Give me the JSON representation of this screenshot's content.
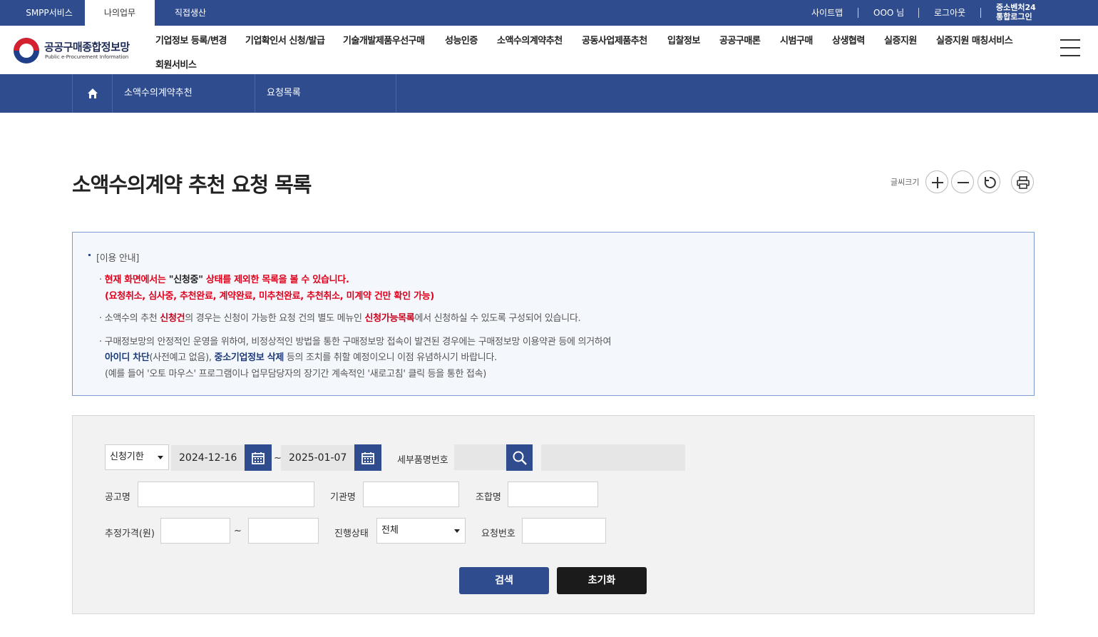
{
  "topbar": {
    "tabs": [
      {
        "label": "SMPP서비스",
        "active": false
      },
      {
        "label": "나의업무",
        "active": true
      },
      {
        "label": "직접생산",
        "active": false
      }
    ],
    "util": {
      "sitemap": "사이트맵",
      "user": "OOO 님",
      "logout": "로그아웃",
      "login24_line1": "중소벤처24",
      "login24_line2": "통합로그인"
    }
  },
  "header": {
    "logo_title": "공공구매종합정보망",
    "logo_sub": "Public e-Procurement Information",
    "gnb": [
      "기업정보 등록/변경",
      "기업확인서 신청/발급",
      "기술개발제품우선구매",
      "성능인증",
      "소액수의계약추천",
      "공동사업제품추천",
      "입찰정보",
      "공공구매론",
      "시범구매",
      "상생협력",
      "실증지원",
      "실증지원 매칭서비스",
      "회원서비스"
    ]
  },
  "location": {
    "crumb1": "소액수의계약추천",
    "crumb2": "요청목록"
  },
  "page": {
    "title": "소액수의계약 추천 요청 목록",
    "font_size_label": "글씨크기"
  },
  "notice": {
    "heading": "[이용 안내]",
    "l1_a": "· ",
    "l1_b": "현재 화면에서는 ",
    "l1_c": "\"신청중\"",
    "l1_d": " 상태를 제외한 목록을 볼 수 있습니다.",
    "l2": "(요청취소, 심사중, 추천완료, 계약완료, 미추천완료, 추천취소, 미계약 건만 확인 가능)",
    "l3_a": "· 소액수의 추천 ",
    "l3_b": "신청건",
    "l3_c": "의 경우는 신청이 가능한 요청 건의 별도 메뉴인 ",
    "l3_d": "신청가능목록",
    "l3_e": "에서 신청하실 수 있도록 구성되어 있습니다.",
    "l4": "· 구매정보망의 안정적인 운영을 위하여, 비정상적인 방법을 통한 구매정보망 접속이 발견된 경우에는 구매정보망 이용약관 등에 의거하여",
    "l5_a": "아이디 차단",
    "l5_b": "(사전예고 없음), ",
    "l5_c": "중소기업정보 삭제",
    "l5_d": " 등의 조치를 취할 예정이오니 이점 유념하시기 바랍니다.",
    "l6": "(예를 들어 '오토 마우스' 프로그램이나 업무담당자의 장기간 계속적인 '새로고침' 클릭 등을 통한 접속)"
  },
  "search": {
    "period_select": "신청기한",
    "date_from": "2024-12-16",
    "date_sep": "~",
    "date_to": "2025-01-07",
    "item_no_label": "세부품명번호",
    "notice_name_label": "공고명",
    "agency_label": "기관명",
    "union_label": "조합명",
    "price_label": "추정가격(원)",
    "price_sep": "~",
    "status_label": "진행상태",
    "status_value": "전체",
    "request_no_label": "요청번호",
    "search_button": "검색",
    "reset_button": "초기화"
  },
  "colors": {
    "primary": "#2f4c8f",
    "notice_border": "#7d9cd0",
    "emphasis_red": "#e0001b",
    "reset_button": "#1b1b1b"
  }
}
